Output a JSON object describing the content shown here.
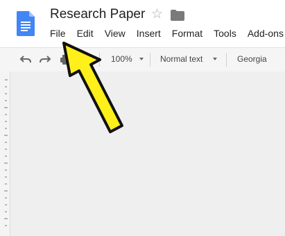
{
  "document": {
    "title": "Research Paper"
  },
  "header": {
    "star_icon": "star-outline-icon",
    "folder_icon": "folder-icon",
    "logo_icon": "google-docs-logo"
  },
  "menu": {
    "items": [
      "File",
      "Edit",
      "View",
      "Insert",
      "Format",
      "Tools",
      "Add-ons"
    ]
  },
  "toolbar": {
    "zoom": "100%",
    "style": "Normal text",
    "font": "Georgia",
    "icons": [
      "undo-icon",
      "redo-icon",
      "print-icon",
      "paint-format-icon"
    ]
  },
  "annotation": {
    "arrow_color": "#ffef1a",
    "outline_color": "#111111"
  },
  "colors": {
    "docs_blue": "#4285f4",
    "toolbar_bg": "#f5f5f5",
    "canvas_bg": "#efefef"
  }
}
